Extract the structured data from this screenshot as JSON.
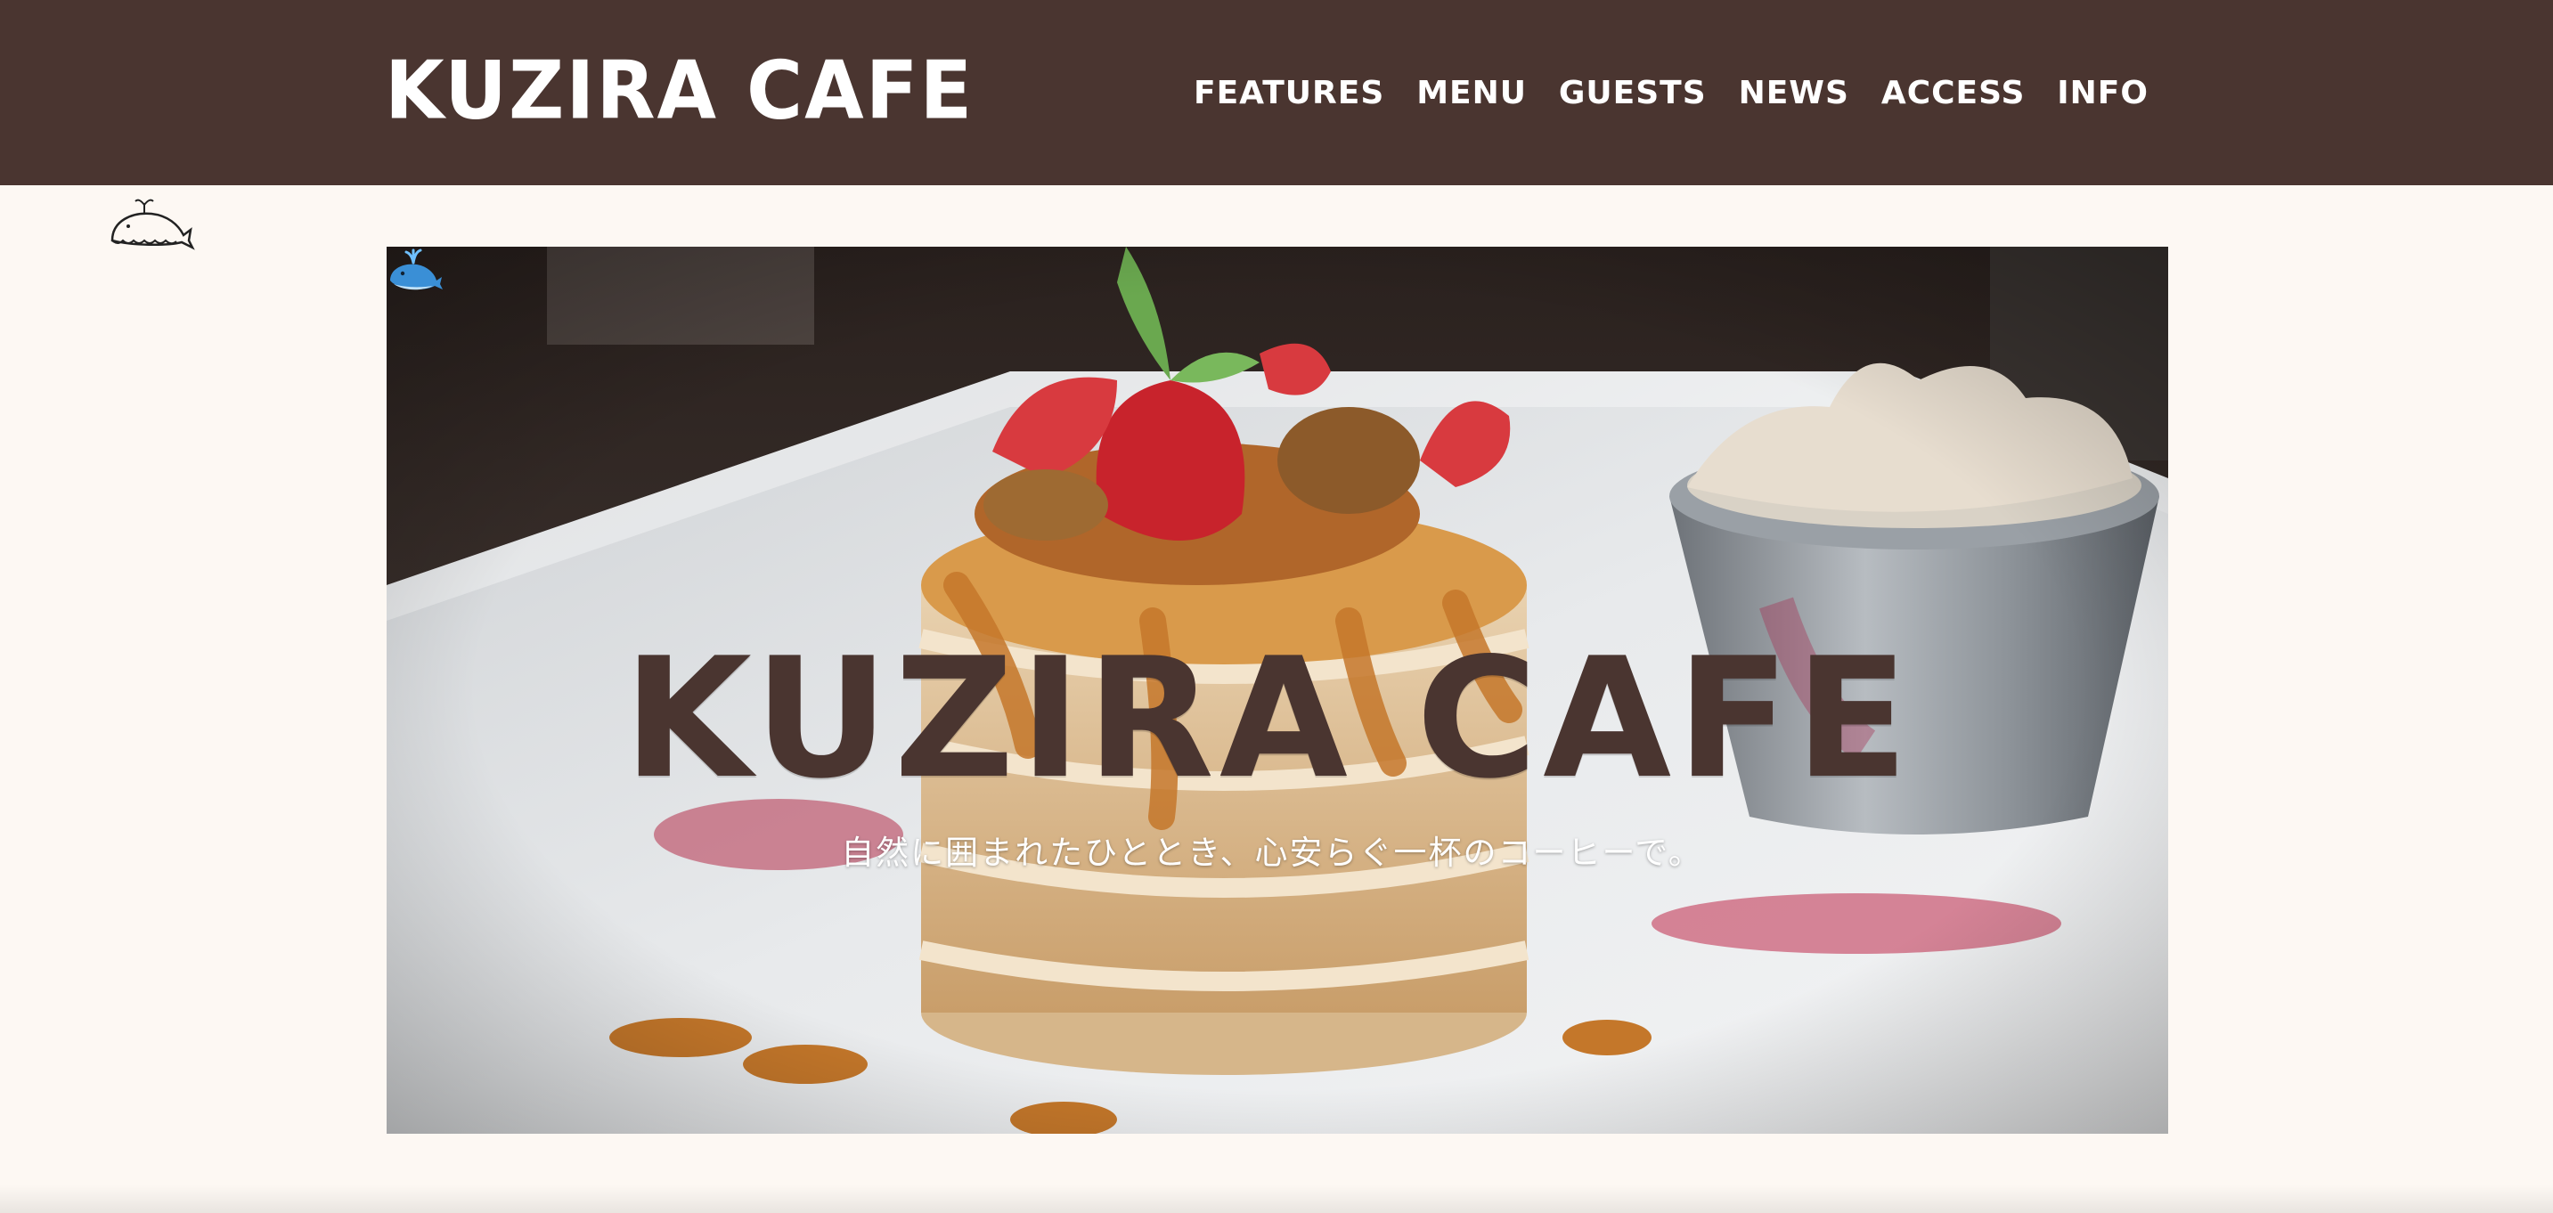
{
  "header": {
    "logo_text": "KUZIRA CAFE",
    "nav": [
      {
        "label": "FEATURES"
      },
      {
        "label": "MENU"
      },
      {
        "label": "GUESTS"
      },
      {
        "label": "NEWS"
      },
      {
        "label": "ACCESS"
      },
      {
        "label": "INFO"
      }
    ]
  },
  "hero": {
    "title": "KUZIRA CAFE",
    "tagline": "自然に囲まれたひととき、心安らぐ一杯のコーヒーで。",
    "image_icon": "pancake-photo"
  },
  "colors": {
    "header_bg": "#4a3530",
    "page_bg": "#fdf8f3",
    "title": "#4a3530",
    "nav_text": "#ffffff"
  },
  "icons": {
    "corner": "whale-icon",
    "hero_emoji": "spouting-whale-icon"
  }
}
